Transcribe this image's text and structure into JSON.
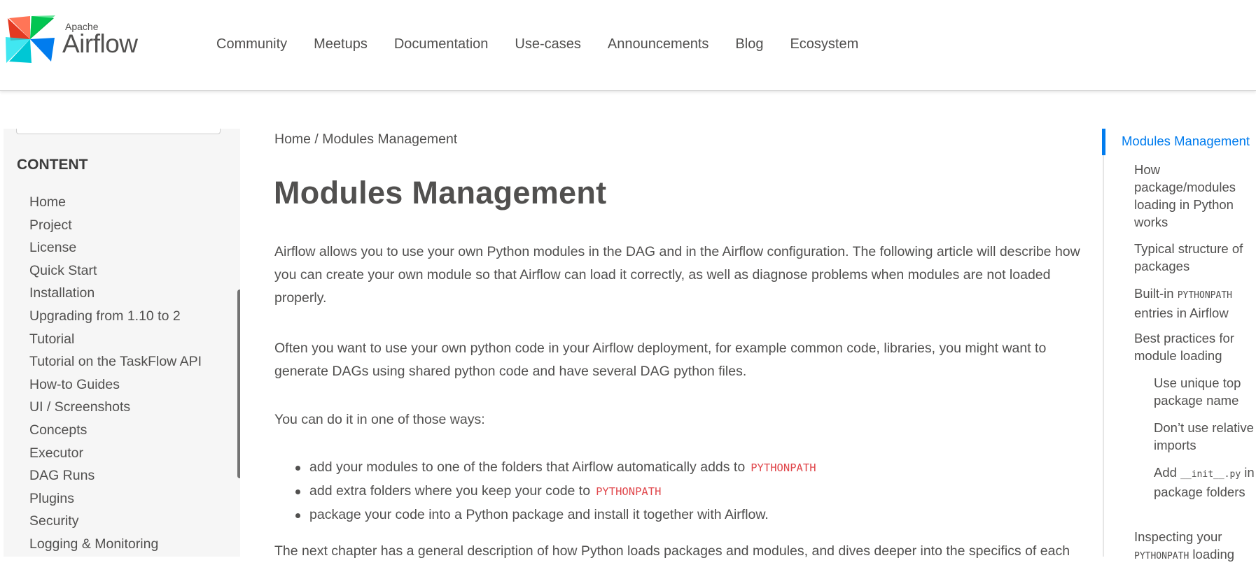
{
  "header": {
    "logo_small": "Apache",
    "logo_big": "Airflow",
    "nav": [
      "Community",
      "Meetups",
      "Documentation",
      "Use-cases",
      "Announcements",
      "Blog",
      "Ecosystem"
    ]
  },
  "sidebar": {
    "heading": "CONTENT",
    "items": [
      "Home",
      "Project",
      "License",
      "Quick Start",
      "Installation",
      "Upgrading from 1.10 to 2",
      "Tutorial",
      "Tutorial on the TaskFlow API",
      "How-to Guides",
      "UI / Screenshots",
      "Concepts",
      "Executor",
      "DAG Runs",
      "Plugins",
      "Security",
      "Logging & Monitoring"
    ]
  },
  "main": {
    "breadcrumb": "Home / Modules Management",
    "title": "Modules Management",
    "p1": "Airflow allows you to use your own Python modules in the DAG and in the Airflow configuration. The following article will describe how you can create your own module so that Airflow can load it correctly, as well as diagnose problems when modules are not loaded properly.",
    "p2": "Often you want to use your own python code in your Airflow deployment, for example common code, libraries, you might want to generate DAGs using shared python code and have several DAG python files.",
    "p3": "You can do it in one of those ways:",
    "bullets": [
      {
        "text": "add your modules to one of the folders that Airflow automatically adds to",
        "code": "PYTHONPATH"
      },
      {
        "text": "add extra folders where you keep your code to",
        "code": "PYTHONPATH"
      },
      {
        "text": "package your code into a Python package and install it together with Airflow.",
        "code": ""
      }
    ],
    "p4": "The next chapter has a general description of how Python loads packages and modules, and dives deeper into the specifics of each"
  },
  "toc": {
    "active": "Modules Management",
    "item1": "How package/modules loading in Python works",
    "item2": "Typical structure of packages",
    "item3_pre": "Built-in",
    "item3_code": "PYTHONPATH",
    "item3_post": "entries in Airflow",
    "item4": "Best practices for module loading",
    "item5": "Use unique top package name",
    "item6": "Don’t use relative imports",
    "item7_pre": "Add",
    "item7_code": "__init__.py",
    "item7_post": "in package folders",
    "item8_pre": "Inspecting your",
    "item8_code": "PYTHONPATH",
    "item8_post": "loading"
  },
  "colors": {
    "accent": "#017cee",
    "code": "#e0474c",
    "text": "#51504f"
  },
  "icons": {
    "logo": "airflow-pinwheel-logo"
  }
}
